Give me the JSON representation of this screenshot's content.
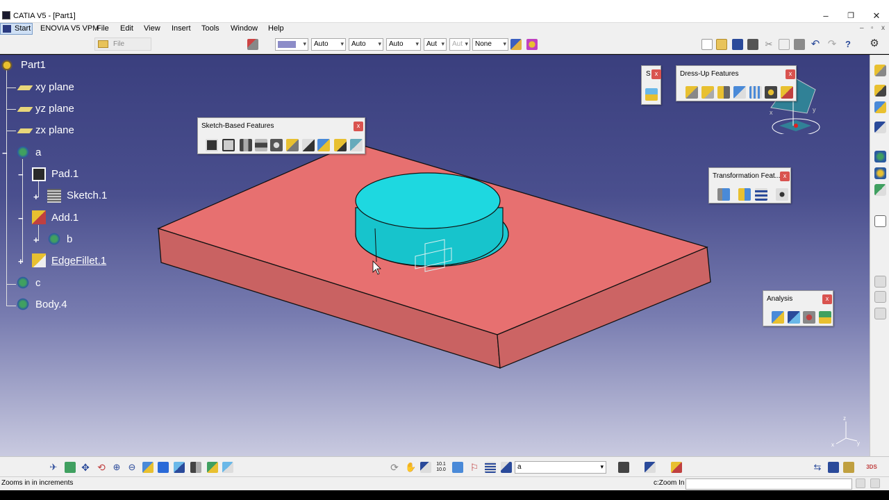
{
  "window": {
    "title": "CATIA V5 - [Part1]",
    "minimize": "–",
    "restore": "❐",
    "close": "✕"
  },
  "menu": {
    "start": "Start",
    "items": [
      "ENOVIA V5 VPM",
      "File",
      "Edit",
      "View",
      "Insert",
      "Tools",
      "Window",
      "Help"
    ]
  },
  "toolbar": {
    "file_label": "File",
    "combos": [
      "Auto",
      "Auto",
      "Auto",
      "Aut",
      "Aut",
      "None"
    ],
    "color_swatch": "#8c8cc8"
  },
  "tree": {
    "root": "Part1",
    "planes": [
      "xy plane",
      "yz plane",
      "zx plane"
    ],
    "body_a": "a",
    "pad": "Pad.1",
    "sketch": "Sketch.1",
    "add": "Add.1",
    "body_b": "b",
    "fillet": "EdgeFillet.1",
    "body_c": "c",
    "body4": "Body.4"
  },
  "panels": {
    "sketch_based": {
      "title": "Sketch-Based Features",
      "close": "x"
    },
    "s_panel": {
      "title": "S",
      "close": "x"
    },
    "dress_up": {
      "title": "Dress-Up Features",
      "close": "x"
    },
    "transformation": {
      "title": "Transformation Feat...",
      "close": "x"
    },
    "analysis": {
      "title": "Analysis",
      "close": "x"
    }
  },
  "statusbar": {
    "layer_value": "a"
  },
  "messages": {
    "status": "Zooms in in increments",
    "command_label": "c:Zoom In"
  },
  "compass": {
    "x": "x",
    "y": "y",
    "z": "z"
  },
  "colors": {
    "viewport_top": "#3a3f7e",
    "part_face": "#e87070",
    "cylinder": "#1ed8e0",
    "tree_text": "#ffffff"
  }
}
